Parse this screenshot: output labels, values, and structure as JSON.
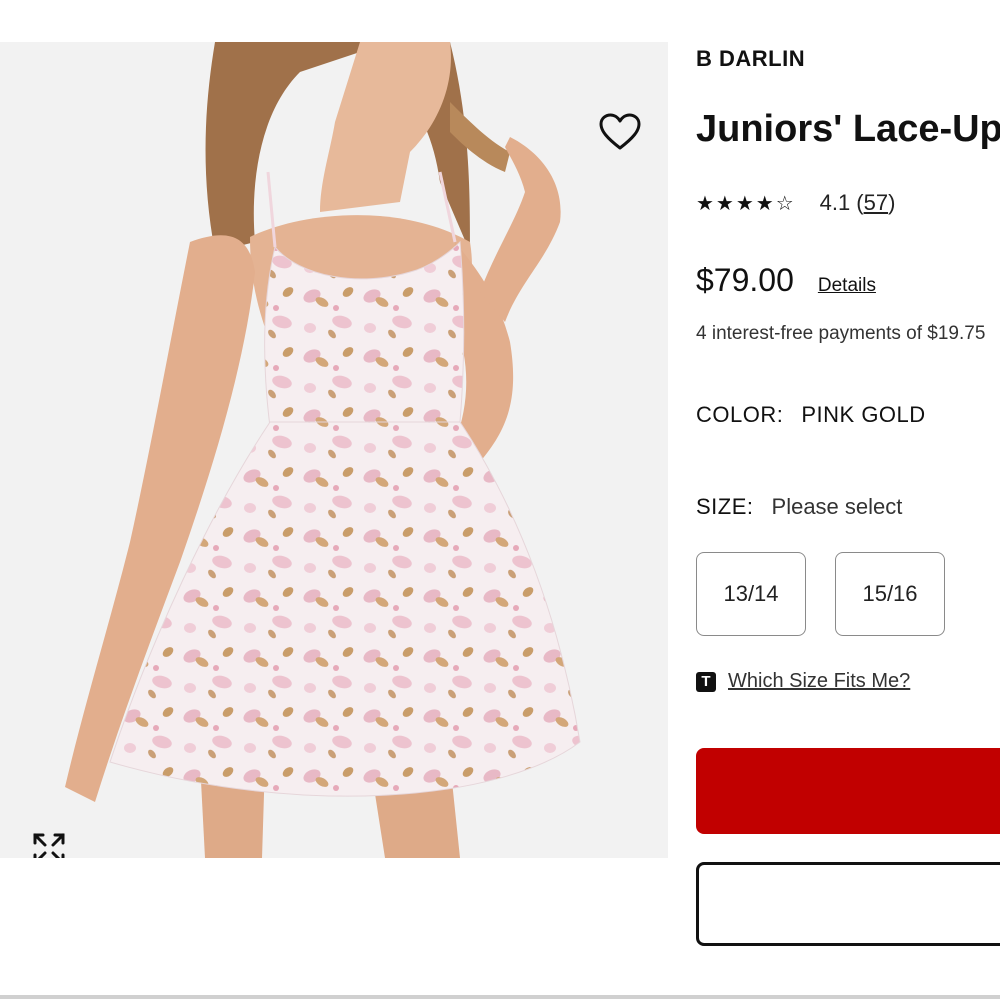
{
  "product": {
    "brand": "B DARLIN",
    "title": "Juniors' Lace-Up",
    "stars": "★★★★☆",
    "rating_value": "4.1",
    "rating_count": "57",
    "rating_open": "(",
    "rating_close": ")",
    "price": "$79.00",
    "details_link": "Details",
    "installments": "4 interest-free payments of $19.75",
    "color_label": "COLOR:",
    "color_value": "PINK GOLD",
    "size_label": "SIZE:",
    "size_value": "Please select",
    "sizes": [
      "13/14",
      "15/16"
    ],
    "fit_icon_letter": "T",
    "fit_link": "Which Size Fits Me?"
  },
  "icons": {
    "wishlist": "heart-outline-icon",
    "expand": "expand-arrows-icon",
    "fit": "true-fit-icon"
  },
  "colors": {
    "primary_button": "#c10000",
    "image_background": "#f2f2f2",
    "text": "#111111"
  }
}
